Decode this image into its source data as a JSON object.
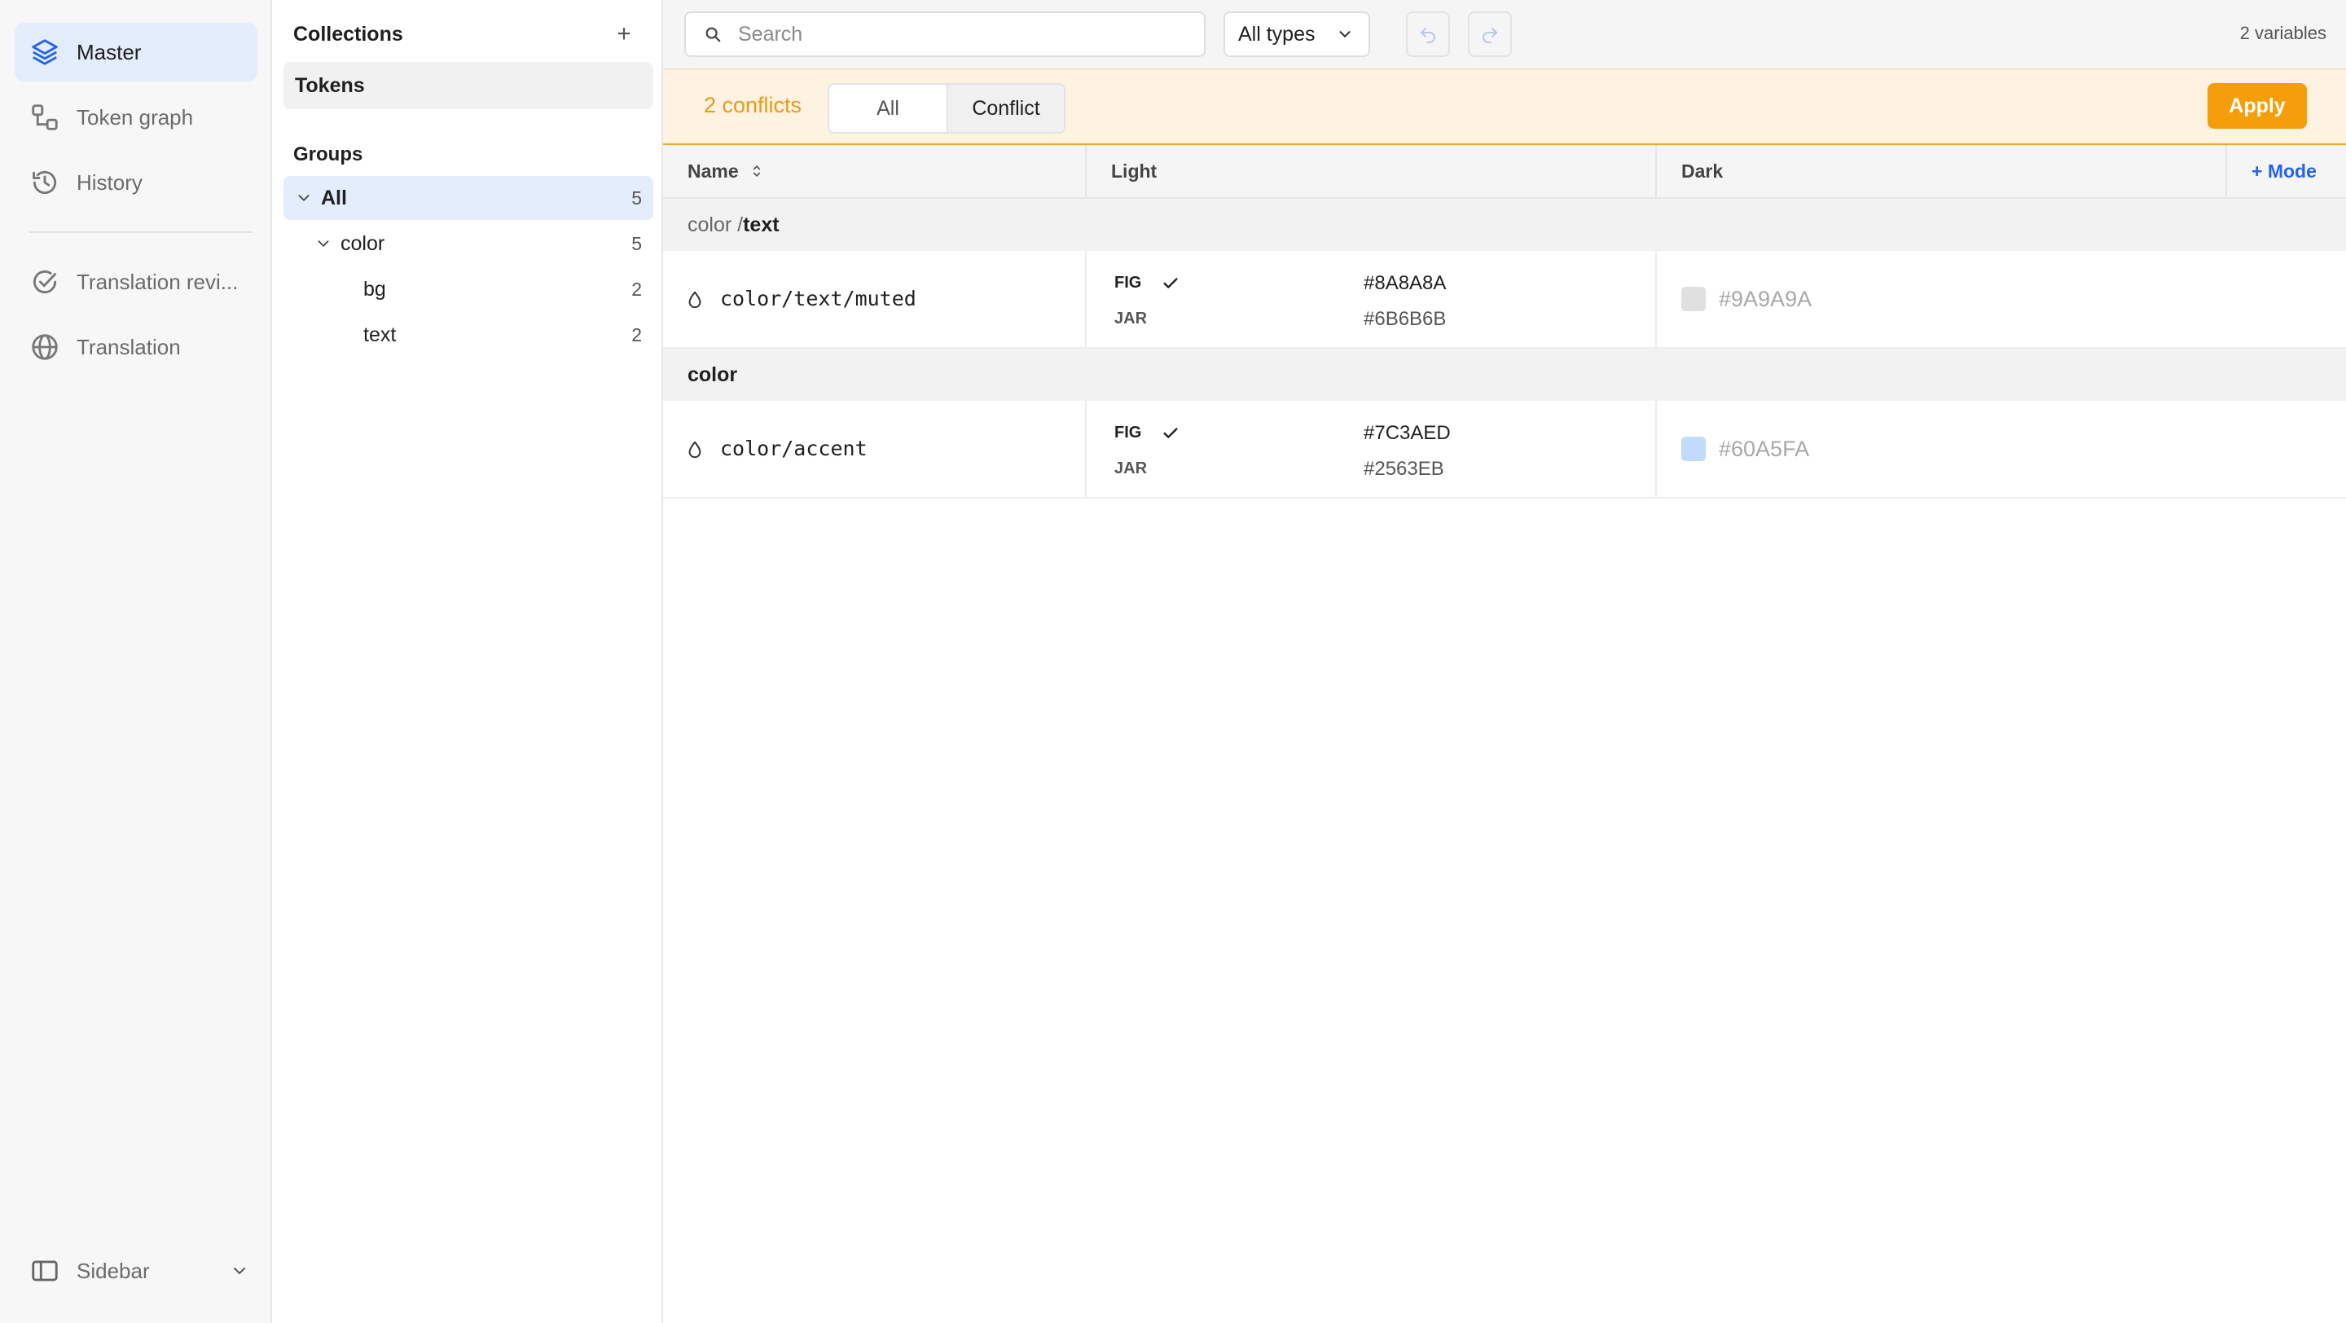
{
  "nav": {
    "items": [
      {
        "label": "Master",
        "icon": "layers-icon",
        "active": true
      },
      {
        "label": "Token graph",
        "icon": "token-graph-icon",
        "active": false
      },
      {
        "label": "History",
        "icon": "history-icon",
        "active": false
      },
      {
        "label": "Translation revi...",
        "icon": "check-circle-icon",
        "active": false
      },
      {
        "label": "Translation",
        "icon": "globe-icon",
        "active": false
      }
    ],
    "footer_label": "Sidebar"
  },
  "collections": {
    "title": "Collections",
    "add_label": "+",
    "items": [
      "Tokens"
    ],
    "groups_title": "Groups",
    "groups": [
      {
        "name": "All",
        "count": "5"
      },
      {
        "name": "color",
        "count": "5"
      },
      {
        "name": "bg",
        "count": "2"
      },
      {
        "name": "text",
        "count": "2"
      }
    ]
  },
  "toolbar": {
    "search_placeholder": "Search",
    "types_label": "All types",
    "variable_count": "2 variables"
  },
  "conflicts": {
    "count_label": "2 conflicts",
    "filter_all": "All",
    "filter_conflict": "Conflict",
    "apply_label": "Apply"
  },
  "table": {
    "headers": {
      "name": "Name",
      "light": "Light",
      "dark": "Dark",
      "add_mode": "+ Mode"
    },
    "groups": [
      {
        "prefix": "color /",
        "leaf": "text",
        "token": {
          "name": "color/text/muted",
          "light": {
            "fig_label": "FIG",
            "jar_label": "JAR",
            "fig_value": "#8A8A8A",
            "jar_value": "#6B6B6B"
          },
          "dark": {
            "value": "#9A9A9A",
            "swatch": "#e0e0e0"
          }
        }
      },
      {
        "prefix": "",
        "leaf": "color",
        "token": {
          "name": "color/accent",
          "light": {
            "fig_label": "FIG",
            "jar_label": "JAR",
            "fig_value": "#7C3AED",
            "jar_value": "#2563EB"
          },
          "dark": {
            "value": "#60A5FA",
            "swatch": "#bfdbfe"
          }
        }
      }
    ]
  },
  "colors": {
    "accent_blue": "#2563eb",
    "warning_orange": "#f59e0b",
    "active_nav_bg": "#e3edfb"
  }
}
